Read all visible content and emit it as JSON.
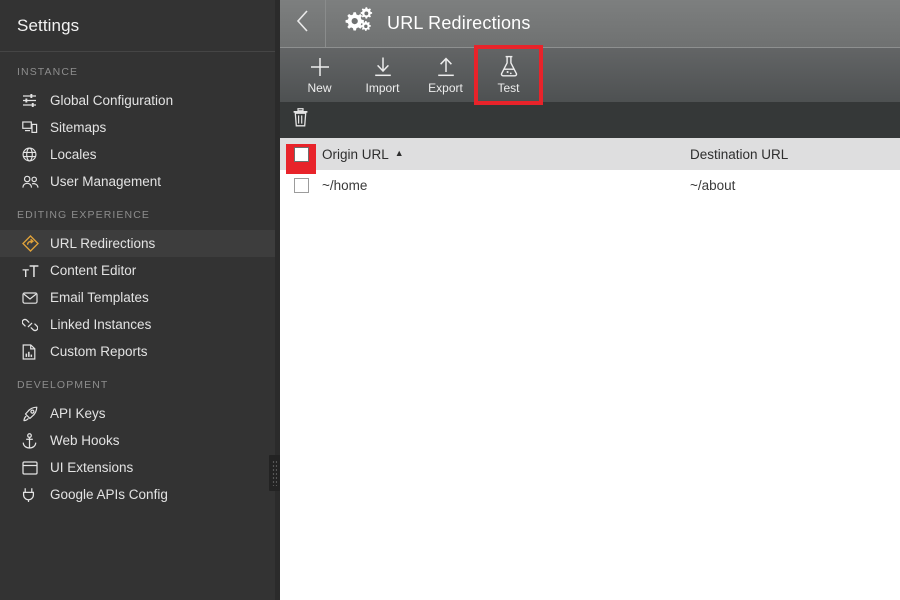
{
  "sidebar": {
    "title": "Settings",
    "sections": [
      {
        "label": "INSTANCE",
        "items": [
          {
            "label": "Global Configuration",
            "icon": "sliders-icon",
            "active": false
          },
          {
            "label": "Sitemaps",
            "icon": "sitemap-screens-icon",
            "active": false
          },
          {
            "label": "Locales",
            "icon": "globe-icon",
            "active": false
          },
          {
            "label": "User Management",
            "icon": "users-icon",
            "active": false
          }
        ]
      },
      {
        "label": "EDITING EXPERIENCE",
        "items": [
          {
            "label": "URL Redirections",
            "icon": "redirect-diamond-icon",
            "active": true
          },
          {
            "label": "Content Editor",
            "icon": "text-format-icon",
            "active": false
          },
          {
            "label": "Email Templates",
            "icon": "envelope-icon",
            "active": false
          },
          {
            "label": "Linked Instances",
            "icon": "link-chain-icon",
            "active": false
          },
          {
            "label": "Custom Reports",
            "icon": "report-document-icon",
            "active": false
          }
        ]
      },
      {
        "label": "DEVELOPMENT",
        "items": [
          {
            "label": "API Keys",
            "icon": "rocket-icon",
            "active": false
          },
          {
            "label": "Web Hooks",
            "icon": "anchor-icon",
            "active": false
          },
          {
            "label": "UI Extensions",
            "icon": "window-icon",
            "active": false
          },
          {
            "label": "Google APIs Config",
            "icon": "plug-icon",
            "active": false
          }
        ]
      }
    ],
    "resizer_name": "sidebar-resize-handle"
  },
  "header": {
    "back_icon": "chevron-left-icon",
    "brand_icon": "gears-icon",
    "title": "URL Redirections"
  },
  "toolbar": {
    "buttons": [
      {
        "label": "New",
        "icon": "plus-icon",
        "highlighted": false
      },
      {
        "label": "Import",
        "icon": "download-arrow-icon",
        "highlighted": false
      },
      {
        "label": "Export",
        "icon": "upload-arrow-icon",
        "highlighted": false
      },
      {
        "label": "Test",
        "icon": "flask-icon",
        "highlighted": true
      }
    ]
  },
  "action_bar": {
    "delete_icon": "trash-icon"
  },
  "table": {
    "select_all_checked": false,
    "select_all_highlighted": true,
    "columns": [
      {
        "key": "origin",
        "label": "Origin URL",
        "sort": "asc",
        "sort_icon": "caret-up-icon"
      },
      {
        "key": "destination",
        "label": "Destination URL",
        "sort": null,
        "sort_icon": ""
      }
    ],
    "rows": [
      {
        "checked": false,
        "origin": "~/home",
        "destination": "~/about"
      }
    ]
  },
  "colors": {
    "accent_highlight": "#e8232a",
    "sidebar_bg": "#333333",
    "sidebar_active": "#3d3d3d",
    "topbar_bg": "#757777",
    "toolbar_bg": "#585b5c",
    "action_bar_bg": "#353838",
    "table_header_bg": "#dededf",
    "redirect_icon": "#e0a23a"
  }
}
